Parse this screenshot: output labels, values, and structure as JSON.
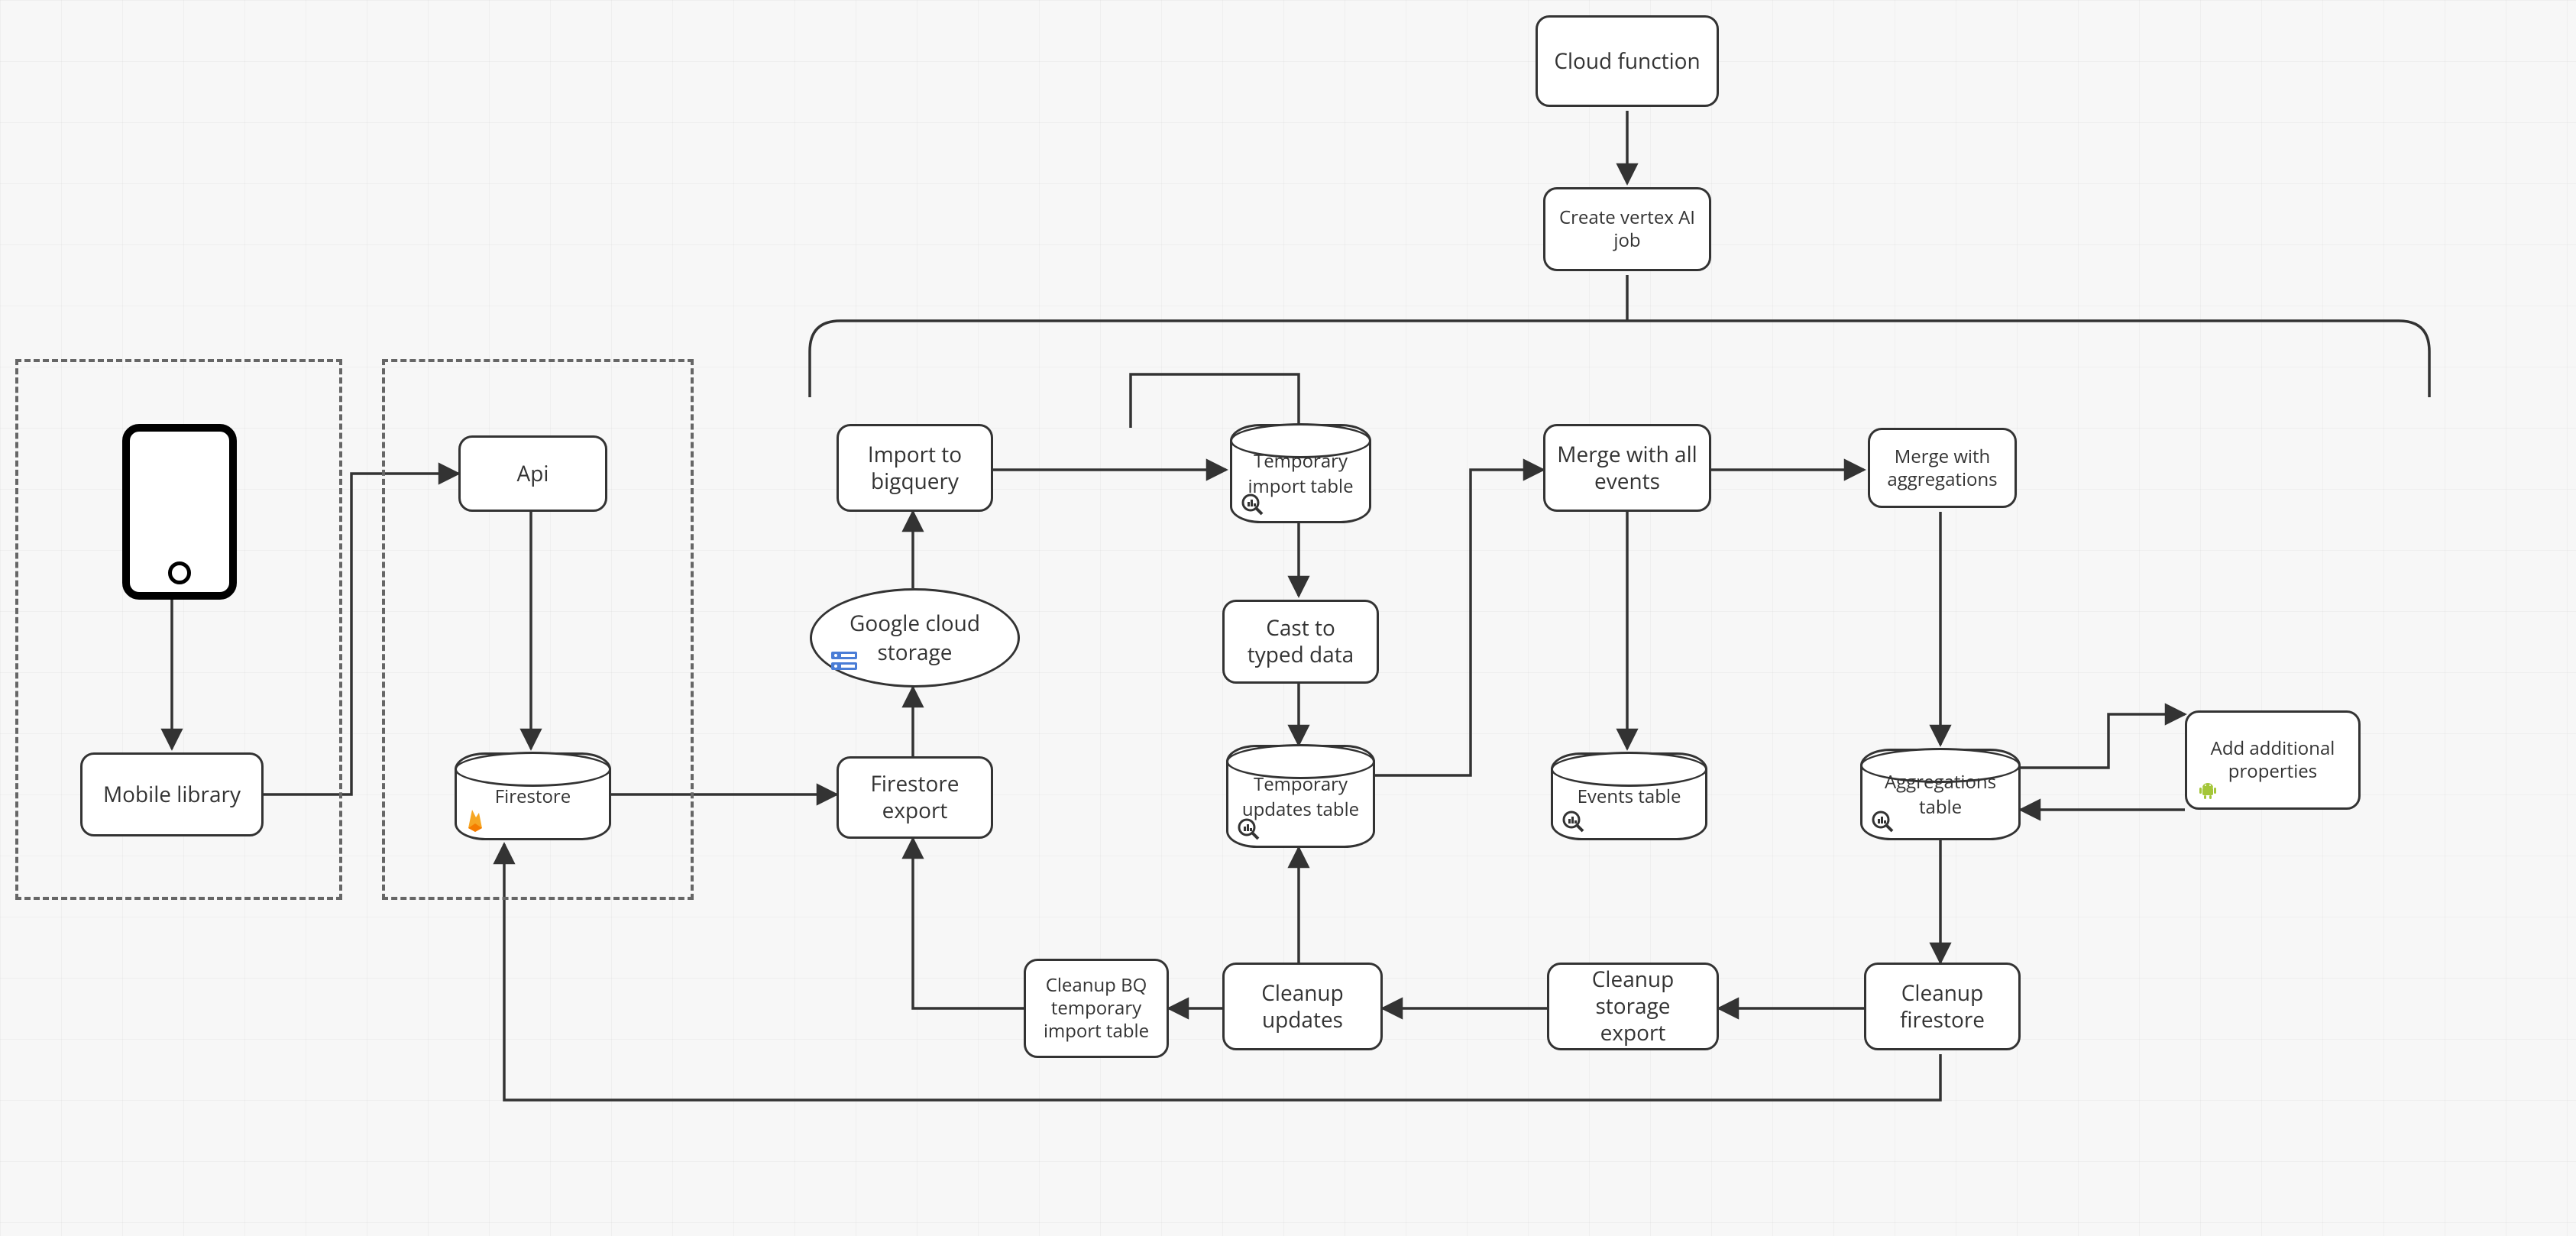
{
  "nodes": {
    "cloud_function": "Cloud function",
    "create_vertex": "Create vertex AI job",
    "api": "Api",
    "mobile_library": "Mobile library",
    "import_bq": "Import to bigquery",
    "gcs": "Google cloud storage",
    "firestore_export": "Firestore export",
    "firestore": "Firestore",
    "tmp_import_table": "Temporary import table",
    "cast_typed": "Cast to typed data",
    "tmp_updates_table": "Temporary updates table",
    "merge_all_events": "Merge with all events",
    "events_table": "Events table",
    "merge_aggr": "Merge with aggregations",
    "aggr_table": "Aggregations table",
    "add_props": "Add additional properties",
    "cleanup_bq_tmp": "Cleanup BQ temporary import table",
    "cleanup_updates": "Cleanup updates",
    "cleanup_storage": "Cleanup storage export",
    "cleanup_firestore": "Cleanup firestore"
  },
  "icons": {
    "bigquery": "bigquery-icon",
    "server": "server-icon",
    "firebase": "firebase-icon",
    "android": "android-icon"
  }
}
